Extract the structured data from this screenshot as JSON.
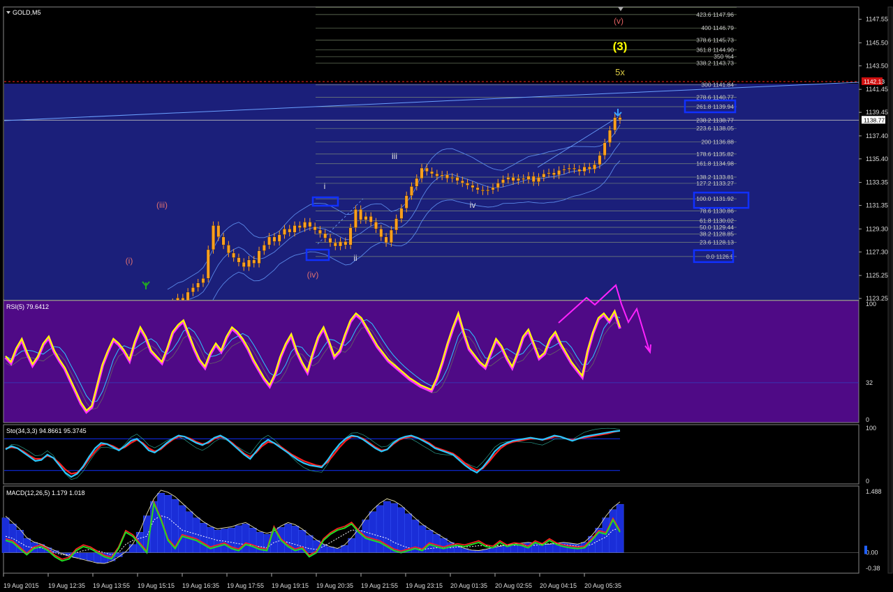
{
  "symbol": "GOLD,M5",
  "colors": {
    "bg": "#000000",
    "main_band": "#1b1f7a",
    "rsi_bg": "#4f0a86",
    "candle": "#ffa01e",
    "rsi_line": "#ffff00",
    "rsi_glow": "#ff33ff",
    "cyan": "#2bc8ff",
    "blue": "#1030ff",
    "red": "#ff2020",
    "green": "#22dd22",
    "fib_text": "#c8c8c8",
    "magenta": "#ff22ff"
  },
  "chart_data": [
    {
      "type": "candlestick",
      "name": "price",
      "ylim": [
        1123.25,
        1148.5
      ],
      "y_ticks": [
        "1147.55",
        "1145.50",
        "1143.50",
        "1141.45",
        "1139.45",
        "1137.40",
        "1135.40",
        "1133.35",
        "1131.35",
        "1129.30",
        "1127.30",
        "1125.25",
        "1123.25"
      ],
      "current_price": "1138.77",
      "stop_level": "1142.13",
      "x_tick_labels": [
        "19 Aug 2015",
        "19 Aug 12:35",
        "19 Aug 13:55",
        "19 Aug 15:15",
        "19 Aug 16:35",
        "19 Aug 17:55",
        "19 Aug 19:15",
        "19 Aug 20:35",
        "19 Aug 21:55",
        "19 Aug 23:15",
        "20 Aug 01:35",
        "20 Aug 02:55",
        "20 Aug 04:15",
        "20 Aug 05:35"
      ],
      "close": [
        1122.6,
        1122.9,
        1123.3,
        1123.0,
        1123.8,
        1124.2,
        1124.6,
        1125.0,
        1127.5,
        1129.6,
        1128.6,
        1127.9,
        1127.2,
        1126.8,
        1126.4,
        1126.0,
        1126.6,
        1126.3,
        1127.4,
        1127.9,
        1128.6,
        1128.2,
        1128.8,
        1129.3,
        1129.0,
        1129.6,
        1129.4,
        1129.9,
        1129.5,
        1129.2,
        1128.9,
        1128.5,
        1128.1,
        1127.8,
        1128.2,
        1127.9,
        1129.4,
        1131.0,
        1130.1,
        1130.4,
        1129.9,
        1129.3,
        1128.6,
        1128.1,
        1129.2,
        1130.2,
        1131.1,
        1132.2,
        1133.0,
        1133.7,
        1134.6,
        1134.3,
        1134.1,
        1133.9,
        1134.0,
        1133.7,
        1133.8,
        1133.5,
        1133.3,
        1133.1,
        1132.9,
        1132.7,
        1132.6,
        1132.7,
        1132.9,
        1133.3,
        1133.6,
        1133.8,
        1133.5,
        1133.7,
        1133.6,
        1133.9,
        1133.4,
        1133.8,
        1134.1,
        1134.2,
        1134.0,
        1134.4,
        1134.5,
        1134.6,
        1134.5,
        1134.3,
        1134.7,
        1134.5,
        1134.9,
        1135.7,
        1136.8,
        1137.9,
        1139.0,
        1138.8
      ],
      "annotations": [
        {
          "label": "(i)",
          "color": "#e07070"
        },
        {
          "label": "(iii)",
          "color": "#e07070"
        },
        {
          "label": "(iv)",
          "color": "#e07070"
        },
        {
          "label": "i",
          "color": "#e0e0e0"
        },
        {
          "label": "ii",
          "color": "#e0e0e0"
        },
        {
          "label": "iii",
          "color": "#e0e0e0"
        },
        {
          "label": "iv",
          "color": "#e0e0e0"
        },
        {
          "label": "(v)",
          "color": "#e06060"
        },
        {
          "label": "(3)",
          "color": "#ffff00"
        },
        {
          "label": "5x",
          "color": "#ddcc44"
        }
      ],
      "fib_levels": [
        {
          "label": "423.6 1147.96",
          "boxed": false
        },
        {
          "label": "400 1146.79",
          "boxed": false
        },
        {
          "label": "378.6 1145.73",
          "boxed": false
        },
        {
          "label": "361.8 1144.90",
          "boxed": false
        },
        {
          "label": "350 %4",
          "boxed": false
        },
        {
          "label": "338.2 1143.73",
          "boxed": false
        },
        {
          "label": "300 1141.84",
          "boxed": false
        },
        {
          "label": "278.6 1140.77",
          "boxed": false
        },
        {
          "label": "261.8 1139.94",
          "boxed": true
        },
        {
          "label": "238.2 1138.77",
          "boxed": false
        },
        {
          "label": "223.6 1138.05",
          "boxed": false
        },
        {
          "label": "200 1136.88",
          "boxed": false
        },
        {
          "label": "178.6 1135.82",
          "boxed": false
        },
        {
          "label": "161.8 1134.98",
          "boxed": false
        },
        {
          "label": "138.2 1133.81",
          "boxed": false
        },
        {
          "label": "127.2 1133.27",
          "boxed": false
        },
        {
          "label": "100.0 1131.92",
          "boxed": true
        },
        {
          "label": "78.6 1130.86",
          "boxed": false
        },
        {
          "label": "61.8 1130.02",
          "boxed": false
        },
        {
          "label": "50.0 1129.44",
          "boxed": false
        },
        {
          "label": "38.2 1128.85",
          "boxed": false
        },
        {
          "label": "23.6 1128.13",
          "boxed": false
        },
        {
          "label": "0.0 1126.9",
          "boxed": true
        }
      ]
    },
    {
      "type": "line",
      "name": "RSI",
      "title": "RSI(5) 79.6412",
      "ylim": [
        0,
        100
      ],
      "y_ticks": [
        "100",
        "32",
        "0"
      ],
      "level": 32,
      "values": [
        55,
        50,
        62,
        70,
        58,
        48,
        55,
        66,
        72,
        60,
        52,
        45,
        35,
        25,
        15,
        8,
        12,
        30,
        48,
        60,
        70,
        66,
        60,
        52,
        68,
        80,
        72,
        60,
        55,
        50,
        62,
        76,
        82,
        86,
        74,
        62,
        52,
        46,
        58,
        66,
        60,
        72,
        80,
        76,
        70,
        62,
        52,
        44,
        36,
        30,
        40,
        55,
        66,
        74,
        60,
        50,
        42,
        58,
        72,
        80,
        68,
        55,
        60,
        74,
        86,
        92,
        88,
        80,
        72,
        64,
        58,
        52,
        48,
        44,
        40,
        36,
        33,
        30,
        28,
        26,
        36,
        50,
        66,
        80,
        92,
        76,
        62,
        56,
        50,
        46,
        58,
        70,
        64,
        54,
        46,
        58,
        72,
        78,
        66,
        54,
        58,
        70,
        76,
        66,
        58,
        50,
        44,
        38,
        60,
        76,
        88,
        92,
        86,
        94,
        80
      ]
    },
    {
      "type": "line",
      "name": "Stochastic",
      "title": "Sto(34,3,3) 94.8661 95.3745",
      "ylim": [
        0,
        100
      ],
      "y_ticks": [
        "100",
        "0"
      ],
      "main": [
        60,
        66,
        62,
        54,
        46,
        38,
        40,
        50,
        44,
        30,
        16,
        8,
        14,
        28,
        46,
        62,
        72,
        70,
        64,
        58,
        66,
        76,
        80,
        70,
        58,
        54,
        62,
        72,
        80,
        86,
        84,
        78,
        72,
        68,
        74,
        82,
        86,
        80,
        70,
        60,
        50,
        42,
        56,
        70,
        78,
        72,
        64,
        56,
        48,
        40,
        34,
        30,
        28,
        26,
        40,
        56,
        70,
        80,
        86,
        84,
        78,
        70,
        62,
        56,
        60,
        72,
        80,
        84,
        86,
        82,
        76,
        70,
        62,
        58,
        54,
        50,
        40,
        30,
        22,
        16,
        26,
        40,
        56,
        66,
        72,
        76,
        78,
        80,
        82,
        80,
        78,
        82,
        86,
        84,
        80,
        76,
        80,
        84,
        86,
        88,
        90,
        92,
        94,
        95
      ],
      "signal": [
        62,
        64,
        62,
        56,
        48,
        42,
        42,
        48,
        44,
        34,
        22,
        14,
        16,
        26,
        42,
        56,
        68,
        70,
        66,
        60,
        64,
        72,
        78,
        72,
        62,
        56,
        60,
        70,
        78,
        84,
        84,
        80,
        74,
        70,
        72,
        80,
        84,
        80,
        72,
        62,
        52,
        46,
        54,
        66,
        74,
        72,
        66,
        58,
        50,
        44,
        38,
        34,
        30,
        28,
        36,
        50,
        64,
        76,
        84,
        84,
        80,
        72,
        64,
        58,
        60,
        70,
        78,
        82,
        84,
        82,
        78,
        72,
        64,
        60,
        56,
        52,
        44,
        34,
        26,
        20,
        24,
        36,
        50,
        62,
        70,
        74,
        76,
        78,
        80,
        80,
        78,
        80,
        84,
        84,
        80,
        78,
        80,
        82,
        84,
        86,
        88,
        90,
        93,
        95
      ]
    },
    {
      "type": "bar",
      "name": "MACD",
      "title": "MACD(12,26,5) 1.179 1.018",
      "ylim": [
        -0.38,
        1.488
      ],
      "y_ticks": [
        "1.488",
        "0.00",
        "-0.38"
      ],
      "histogram": [
        0.85,
        0.7,
        0.55,
        0.35,
        0.25,
        0.2,
        0.12,
        0.05,
        -0.02,
        -0.08,
        -0.12,
        -0.16,
        -0.2,
        -0.24,
        -0.25,
        -0.2,
        -0.1,
        0.02,
        0.2,
        0.5,
        0.9,
        1.25,
        1.45,
        1.4,
        1.3,
        1.15,
        1.0,
        0.85,
        0.72,
        0.62,
        0.55,
        0.58,
        0.6,
        0.66,
        0.7,
        0.6,
        0.5,
        0.45,
        0.5,
        0.62,
        0.7,
        0.65,
        0.55,
        0.42,
        0.3,
        0.2,
        0.14,
        0.1,
        0.18,
        0.35,
        0.55,
        0.8,
        1.0,
        1.15,
        1.25,
        1.2,
        1.1,
        0.95,
        0.8,
        0.66,
        0.55,
        0.45,
        0.35,
        0.25,
        0.16,
        0.1,
        0.06,
        0.05,
        0.08,
        0.12,
        0.15,
        0.18,
        0.2,
        0.22,
        0.24,
        0.22,
        0.2,
        0.2,
        0.22,
        0.24,
        0.22,
        0.2,
        0.25,
        0.4,
        0.6,
        0.85,
        1.05,
        1.18
      ],
      "macd_line": [
        0.3,
        0.25,
        0.1,
        -0.05,
        0.1,
        0.15,
        0.05,
        -0.1,
        -0.2,
        -0.15,
        0.05,
        0.15,
        0.1,
        0.0,
        -0.1,
        -0.15,
        0.1,
        0.5,
        0.4,
        0.2,
        0.0,
        1.2,
        0.8,
        0.3,
        0.1,
        0.4,
        0.35,
        0.3,
        0.2,
        0.1,
        0.15,
        0.2,
        0.1,
        0.05,
        0.2,
        0.15,
        0.08,
        0.05,
        0.6,
        0.3,
        0.15,
        0.05,
        0.1,
        -0.1,
        0.0,
        0.3,
        0.45,
        0.55,
        0.6,
        0.7,
        0.5,
        0.35,
        0.3,
        0.25,
        0.15,
        0.05,
        0.0,
        0.05,
        0.1,
        0.05,
        0.2,
        0.15,
        0.1,
        0.15,
        0.18,
        0.15,
        0.2,
        0.25,
        0.15,
        0.12,
        0.25,
        0.15,
        0.2,
        0.18,
        0.12,
        0.25,
        0.18,
        0.3,
        0.2,
        0.15,
        0.12,
        0.1,
        0.12,
        0.3,
        0.5,
        0.45,
        0.8,
        0.5
      ],
      "signal_line": [
        0.4,
        0.35,
        0.25,
        0.15,
        0.12,
        0.12,
        0.08,
        0.0,
        -0.05,
        -0.05,
        0.0,
        0.05,
        0.08,
        0.05,
        0.0,
        -0.05,
        0.0,
        0.2,
        0.3,
        0.35,
        0.4,
        0.8,
        0.9,
        0.85,
        0.7,
        0.55,
        0.5,
        0.45,
        0.4,
        0.35,
        0.3,
        0.28,
        0.25,
        0.22,
        0.2,
        0.18,
        0.15,
        0.12,
        0.25,
        0.3,
        0.25,
        0.2,
        0.15,
        0.1,
        0.08,
        0.15,
        0.25,
        0.35,
        0.45,
        0.55,
        0.55,
        0.5,
        0.45,
        0.4,
        0.35,
        0.25,
        0.18,
        0.12,
        0.1,
        0.08,
        0.1,
        0.12,
        0.12,
        0.12,
        0.14,
        0.14,
        0.15,
        0.17,
        0.17,
        0.16,
        0.18,
        0.18,
        0.18,
        0.18,
        0.17,
        0.18,
        0.2,
        0.22,
        0.22,
        0.2,
        0.18,
        0.16,
        0.15,
        0.2,
        0.3,
        0.38,
        0.55,
        0.6
      ]
    }
  ]
}
